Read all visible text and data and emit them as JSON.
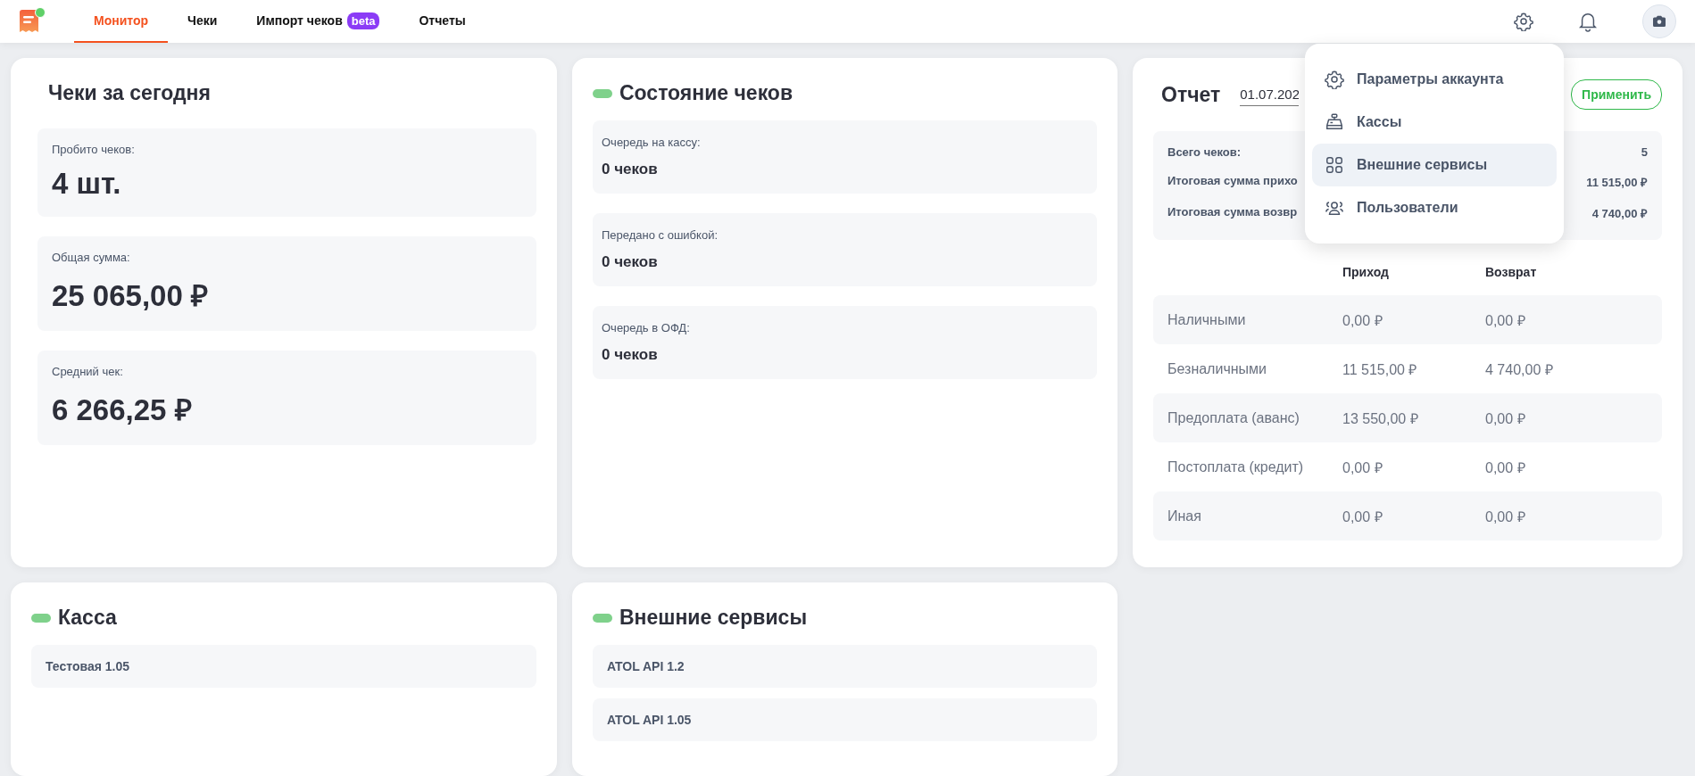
{
  "header": {
    "logo_dot": true,
    "tabs": [
      {
        "label": "Монитор",
        "selected": true
      },
      {
        "label": "Чеки",
        "selected": false
      },
      {
        "label": "Импорт чеков",
        "badge": "beta",
        "selected": false
      },
      {
        "label": "Отчеты",
        "selected": false
      }
    ]
  },
  "today": {
    "title": "Чеки за сегодня",
    "stats": [
      {
        "label": "Пробито чеков:",
        "value": "4 шт."
      },
      {
        "label": "Общая сумма:",
        "value": "25 065,00 ₽"
      },
      {
        "label": "Средний чек:",
        "value": "6 266,25 ₽"
      }
    ]
  },
  "receipt_status": {
    "title": "Состояние чеков",
    "color": "#7fd18b",
    "queues": [
      {
        "label": "Очередь на кассу:",
        "value": "0 чеков"
      },
      {
        "label": "Передано с ошибкой:",
        "value": "0 чеков"
      },
      {
        "label": "Очередь в ОФД:",
        "value": "0 чеков"
      }
    ]
  },
  "report": {
    "title": "Отчет",
    "date": "01.07.202",
    "apply_button": "Применить",
    "summary": [
      {
        "label": "Всего чеков:",
        "value": "5"
      },
      {
        "label": "Итоговая сумма прихо",
        "value": "11 515,00 ₽"
      },
      {
        "label": "Итоговая сумма возвр",
        "value": "4 740,00 ₽"
      }
    ],
    "columns": [
      "Приход",
      "Возврат"
    ],
    "rows": [
      {
        "label": "Наличными",
        "income": "0,00 ₽",
        "refund": "0,00 ₽"
      },
      {
        "label": "Безналичными",
        "income": "11 515,00 ₽",
        "refund": "4 740,00 ₽"
      },
      {
        "label": "Предоплата (аванс)",
        "income": "13 550,00 ₽",
        "refund": "0,00 ₽"
      },
      {
        "label": "Постоплата (кредит)",
        "income": "0,00 ₽",
        "refund": "0,00 ₽"
      },
      {
        "label": "Иная",
        "income": "0,00 ₽",
        "refund": "0,00 ₽"
      }
    ]
  },
  "cashbox": {
    "title": "Касса",
    "color": "#7fd18b",
    "items": [
      "Тестовая 1.05"
    ]
  },
  "services": {
    "title": "Внешние сервисы",
    "color": "#7fd18b",
    "items": [
      "ATOL API 1.2",
      "ATOL API 1.05"
    ]
  },
  "account_menu": {
    "items": [
      {
        "label": "Параметры аккаунта",
        "kind": "settings",
        "selected": false
      },
      {
        "label": "Кассы",
        "kind": "cashboxes",
        "selected": false
      },
      {
        "label": "Внешние сервисы",
        "kind": "services",
        "selected": true
      },
      {
        "label": "Пользователи",
        "kind": "users",
        "selected": false
      }
    ]
  }
}
